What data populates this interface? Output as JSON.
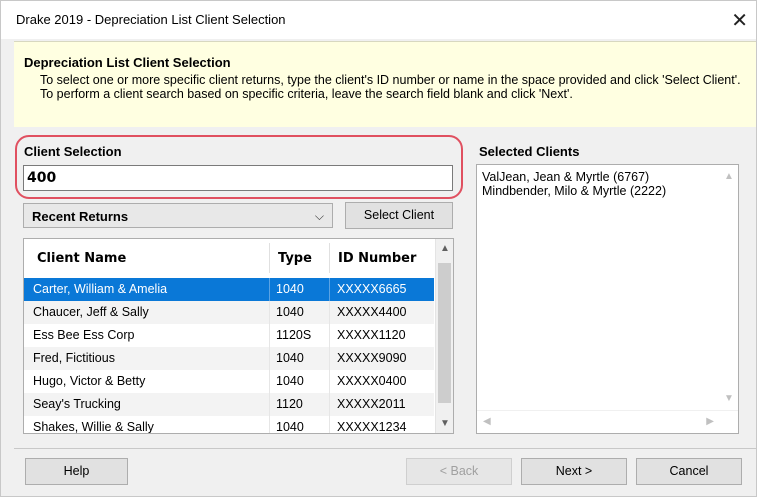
{
  "window": {
    "title": "Drake 2019 - Depreciation List Client Selection",
    "close_glyph": "✕"
  },
  "header": {
    "title": "Depreciation List Client Selection",
    "description": "To select one or more specific client returns, type the client's ID number or name in the space provided and click 'Select Client'. To perform a client search based on specific criteria, leave the search field blank and click 'Next'."
  },
  "client_selection": {
    "label": "Client Selection",
    "value": "400",
    "highlight_color": "#e05060"
  },
  "recent": {
    "selected": "Recent Returns",
    "chevron": "⌵"
  },
  "select_client_label": "Select Client",
  "table": {
    "columns": [
      "Client Name",
      "Type",
      "ID Number"
    ],
    "rows": [
      [
        "Carter, William & Amelia",
        "1040",
        "XXXXX6665"
      ],
      [
        "Chaucer, Jeff & Sally",
        "1040",
        "XXXXX4400"
      ],
      [
        "Ess Bee Ess Corp",
        "1120S",
        "XXXXX1120"
      ],
      [
        "Fred, Fictitious",
        "1040",
        "XXXXX9090"
      ],
      [
        "Hugo, Victor & Betty",
        "1040",
        "XXXXX0400"
      ],
      [
        "Seay's Trucking",
        "1120",
        "XXXXX2011"
      ],
      [
        "Shakes, Willie & Sally",
        "1040",
        "XXXXX1234"
      ]
    ],
    "selected_row": 0,
    "selection_color": "#0a78d7"
  },
  "selected_clients": {
    "label": "Selected Clients",
    "items": [
      "ValJean, Jean & Myrtle (6767)",
      "Mindbender, Milo & Myrtle (2222)"
    ]
  },
  "footer": {
    "help": "Help",
    "back": "< Back",
    "next": "Next >",
    "cancel": "Cancel"
  }
}
